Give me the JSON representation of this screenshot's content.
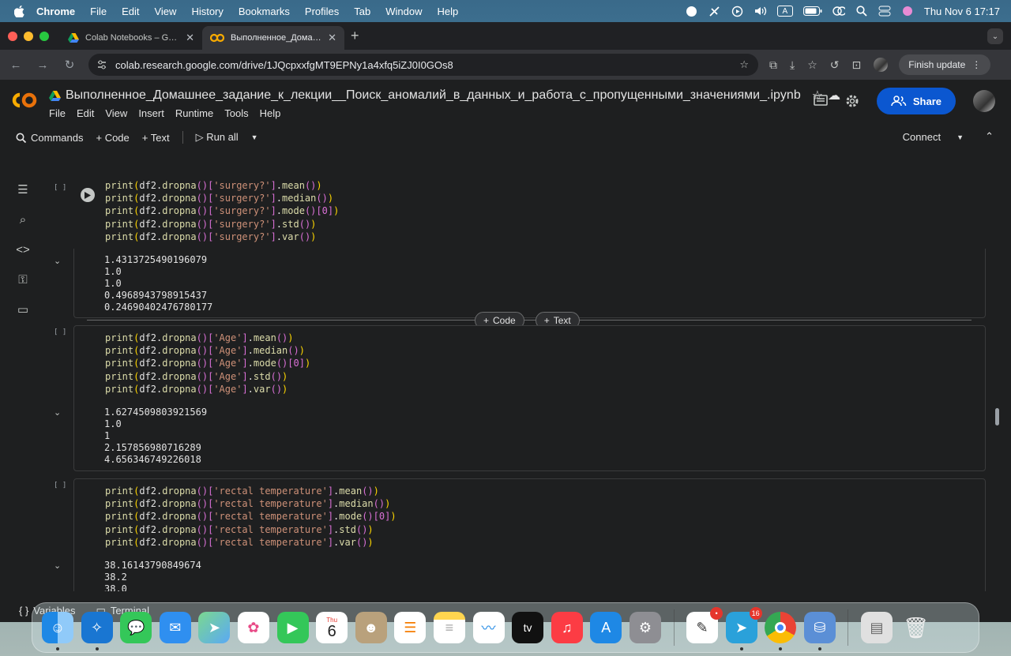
{
  "menubar": {
    "app": "Chrome",
    "items": [
      "File",
      "Edit",
      "View",
      "History",
      "Bookmarks",
      "Profiles",
      "Tab",
      "Window",
      "Help"
    ],
    "input_badge": "A",
    "clock": "Thu Nov 6  17:17"
  },
  "tabs": [
    {
      "title": "Colab Notebooks – Google Д"
    },
    {
      "title": "Выполненное_Домашнее_з"
    }
  ],
  "address": {
    "url": "colab.research.google.com/drive/1JQcpxxfgMT9EPNy1a4xfq5iZJ0I0GOs8"
  },
  "finish_update": "Finish update",
  "colab": {
    "logo": "CO",
    "notebook_title": "Выполненное_Домашнее_задание_к_лекции__Поиск_аномалий_в_данных_и_работа_с_пропущенными_значениями_.ipynb",
    "menu": [
      "File",
      "Edit",
      "View",
      "Insert",
      "Runtime",
      "Tools",
      "Help"
    ],
    "share": "Share",
    "commands": "Commands",
    "add_code": "Code",
    "add_text": "Text",
    "run_all": "Run all",
    "connect": "Connect"
  },
  "cells": [
    {
      "bracket": "[ ]",
      "col": "surgery?",
      "methods": [
        "mean()",
        "median()",
        "mode()[0]",
        "std()",
        "var()"
      ],
      "output": "1.4313725490196079\n1.0\n1.0\n0.4968943798915437\n0.24690402476780177"
    },
    {
      "bracket": "[ ]",
      "col": "Age",
      "methods": [
        "mean()",
        "median()",
        "mode()[0]",
        "std()",
        "var()"
      ],
      "output": "1.6274509803921569\n1.0\n1\n2.157856980716289\n4.656346749226018"
    },
    {
      "bracket": "[ ]",
      "col": "rectal temperature",
      "methods": [
        "mean()",
        "median()",
        "mode()[0]",
        "std()",
        "var()"
      ],
      "output": "38.16143790849674\n38.2\n38.0"
    }
  ],
  "insert_bar": {
    "code": "Code",
    "text": "Text"
  },
  "bottom": {
    "variables": "Variables",
    "terminal": "Terminal"
  },
  "dock": {
    "calendar_month": "Thu",
    "calendar_day": "6",
    "tv_label": "tv",
    "badge_1": "•",
    "badge_2": "16"
  },
  "colors": {
    "accent": "#0b57d0",
    "bg": "#1e1f20",
    "colab_orange": "#f9ab00"
  }
}
